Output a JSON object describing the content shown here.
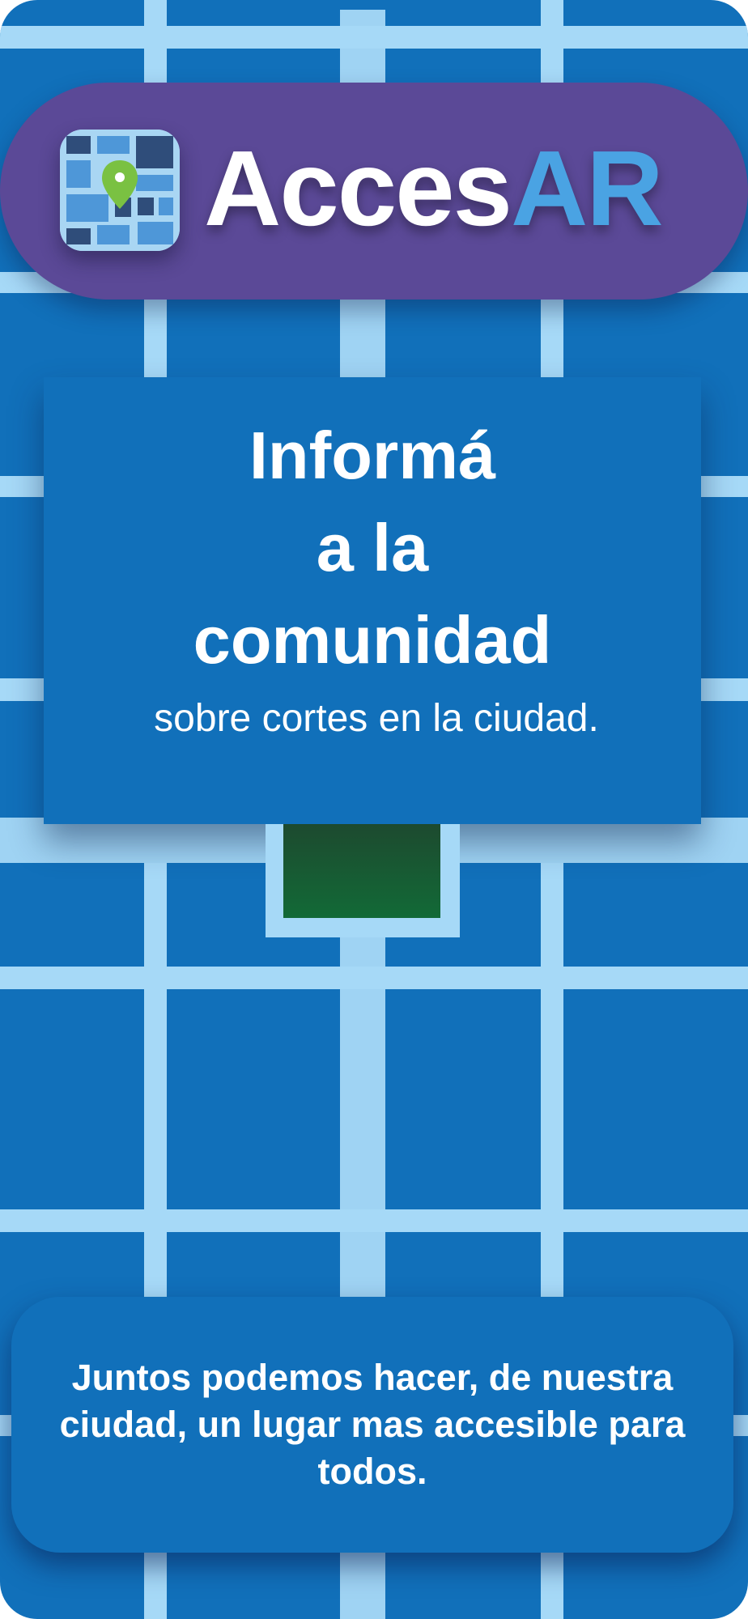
{
  "brand": {
    "logo_part1": "Acces",
    "logo_part2": "AR",
    "icon": "map-pin-icon",
    "colors": {
      "header": "#5b4997",
      "accent": "#4aa3e3",
      "background": "#1170ba",
      "roads": "#a6d9f7",
      "pin": "#7ac142",
      "marker": "#136a37"
    }
  },
  "card": {
    "headline_line1": "Informá",
    "headline_line2": "a la",
    "headline_line3": "comunidad",
    "subline": "sobre cortes en la ciudad."
  },
  "footer": {
    "message": "Juntos podemos hacer, de nuestra ciudad, un lugar mas accesible para todos."
  }
}
